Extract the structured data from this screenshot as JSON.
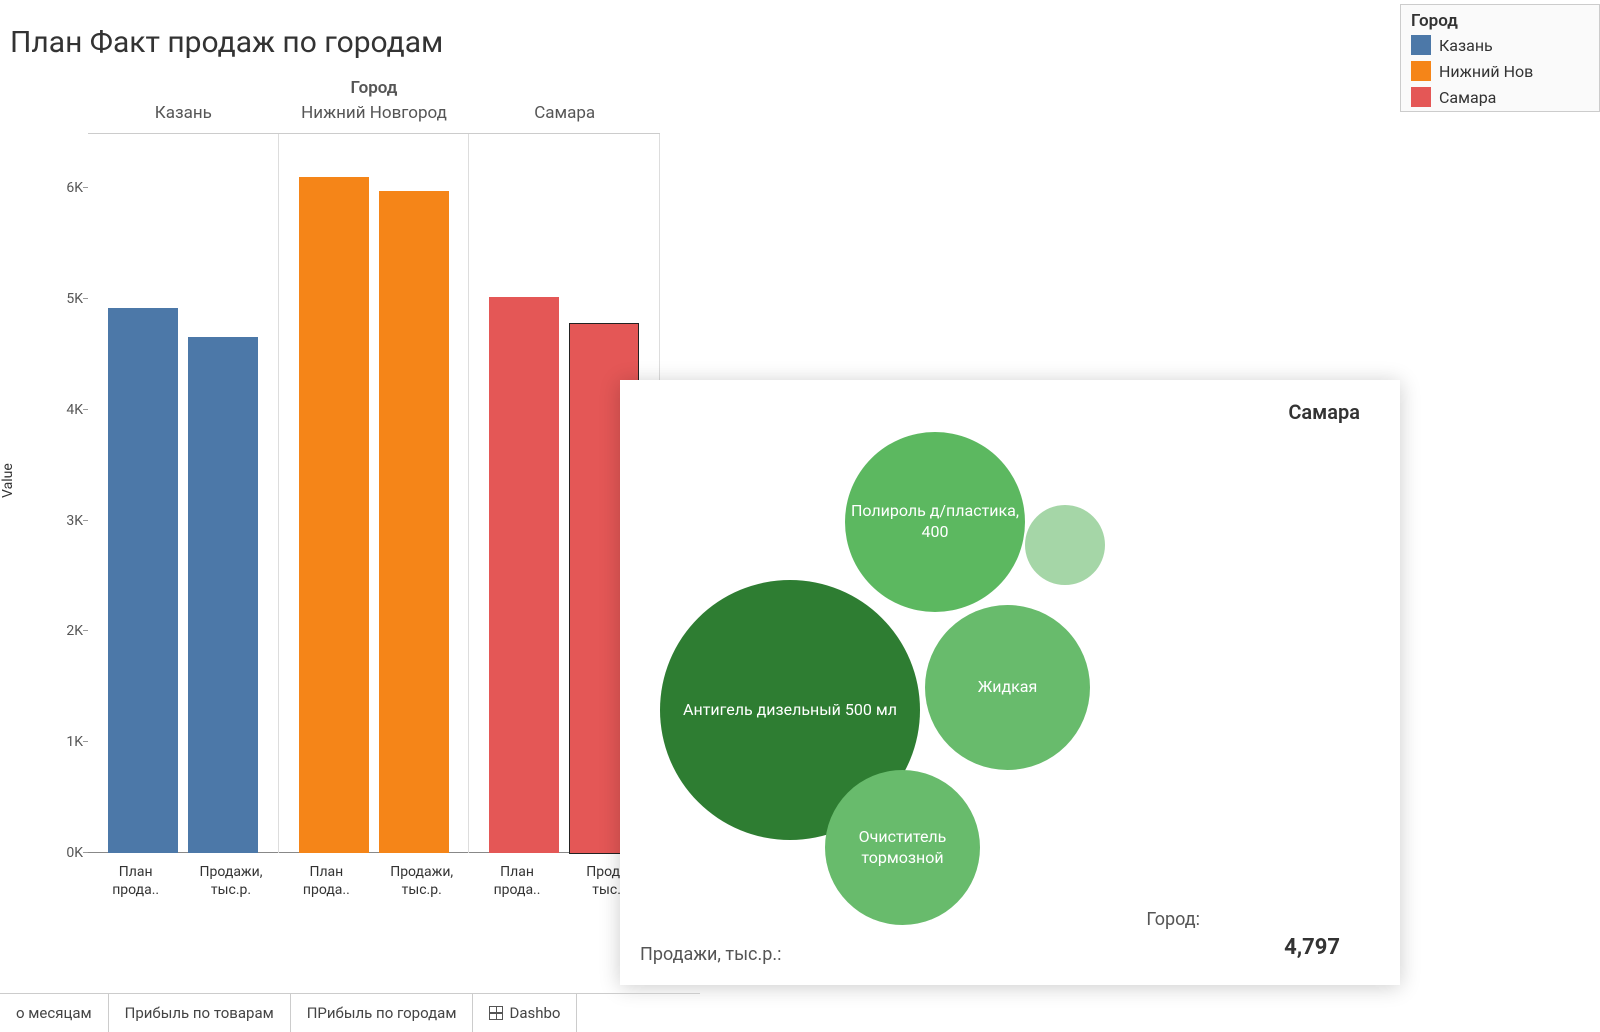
{
  "title": "План Факт продаж по городам",
  "column_header": "Город",
  "y_axis_label": "Value",
  "legend": {
    "title": "Город",
    "items": [
      {
        "label": "Казань",
        "color": "#4c78a8"
      },
      {
        "label": "Нижний Нов",
        "color": "#f58518"
      },
      {
        "label": "Самара",
        "color": "#e45756"
      }
    ]
  },
  "y_ticks": [
    "0K",
    "1K",
    "2K",
    "3K",
    "4K",
    "5K",
    "6K"
  ],
  "cities": [
    "Казань",
    "Нижний Новгород",
    "Самара"
  ],
  "x_labels": {
    "plan": "План\nпрода..",
    "fact": "Продажи,\nтыс.р.",
    "fact_cut": "Продаж\nтыс.р."
  },
  "tooltip": {
    "city_heading": "Самара",
    "bubbles": [
      {
        "label": "Антигель дизельный 500 мл"
      },
      {
        "label": "Полироль д/пластика, 400"
      },
      {
        "label": "Жидкая"
      },
      {
        "label": "Очиститель тормозной"
      },
      {
        "label": ""
      }
    ],
    "footer_label": "Продажи,  тыс.р.:",
    "city_label": "Город:",
    "value": "4,797"
  },
  "tabs": [
    "о месяцам",
    "Прибыль по товарам",
    "ПРибыль по городам",
    "Dashbo"
  ],
  "chart_data": {
    "bar_chart": {
      "type": "bar",
      "title": "План Факт продаж по городам",
      "column_dimension": "Город",
      "ylabel": "Value",
      "ylim": [
        0,
        6500
      ],
      "categories": [
        "Казань",
        "Нижний Новгород",
        "Самара"
      ],
      "series": [
        {
          "name": "План прода..",
          "values": [
            4920,
            6100,
            5020
          ]
        },
        {
          "name": "Продажи, тыс.р.",
          "values": [
            4660,
            5980,
            4797
          ]
        }
      ],
      "colors": {
        "Казань": "#4c78a8",
        "Нижний Новгород": "#f58518",
        "Самара": "#e45756"
      },
      "highlighted": {
        "city": "Самара",
        "measure": "Продажи, тыс.р.",
        "value": 4797
      }
    },
    "bubble_chart": {
      "type": "packed-bubbles",
      "title": "Самара",
      "measure": "Продажи, тыс.р.",
      "items": [
        {
          "label": "Антигель дизельный 500 мл",
          "size_rank": 1,
          "color": "#2e7d32"
        },
        {
          "label": "Полироль д/пластика, 400",
          "size_rank": 2,
          "color": "#5cb860"
        },
        {
          "label": "Жидкая",
          "size_rank": 3,
          "color": "#68bb6c"
        },
        {
          "label": "Очиститель тормозной",
          "size_rank": 4,
          "color": "#68bb6c"
        },
        {
          "label": "",
          "size_rank": 5,
          "color": "#a5d6a7"
        }
      ],
      "total": 4797
    }
  }
}
